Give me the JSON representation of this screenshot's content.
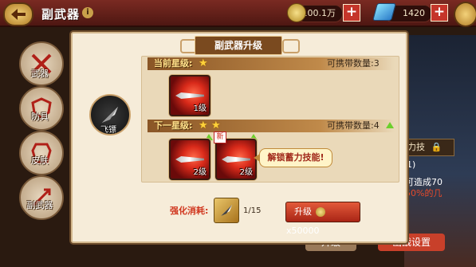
{
  "header": {
    "title": "副武器",
    "info_icon": "i",
    "gold": "100.1万",
    "gems": "1420"
  },
  "side_menu": {
    "items": [
      {
        "label": "武器",
        "icon": "crossed-swords-icon"
      },
      {
        "label": "防具",
        "icon": "shield-icon"
      },
      {
        "label": "皮肤",
        "icon": "armor-icon"
      },
      {
        "label": "副武器",
        "icon": "dart-icon"
      }
    ]
  },
  "background": {
    "skill_lock_label": "力技",
    "partial_text_1": "1)",
    "partial_text_2": "可造成70",
    "partial_text_3": "50%的几",
    "upgrade_btn": "升级",
    "battle_settings_btn": "出战设置"
  },
  "dialog": {
    "title": "副武器升级",
    "weapon_name": "飞镖",
    "current": {
      "label": "当前星级:",
      "stars": 1,
      "capacity": "可携带数量:3",
      "card_level": "1级"
    },
    "next": {
      "label": "下一星级:",
      "stars": 2,
      "capacity": "可携带数量:4",
      "card_levels": [
        "2级",
        "2级"
      ],
      "new_tag": "新",
      "skill_text": "解锁蓄力技能!"
    },
    "cost_label": "强化消耗:",
    "cost_count": "1/15",
    "upgrade_button": "升级",
    "upgrade_cost": "x50000"
  },
  "colors": {
    "accent_red": "#c5352a",
    "dialog_bg": "#f6ecd9",
    "header_brown": "#7a4a1f",
    "gold_star": "#ffd23a"
  }
}
